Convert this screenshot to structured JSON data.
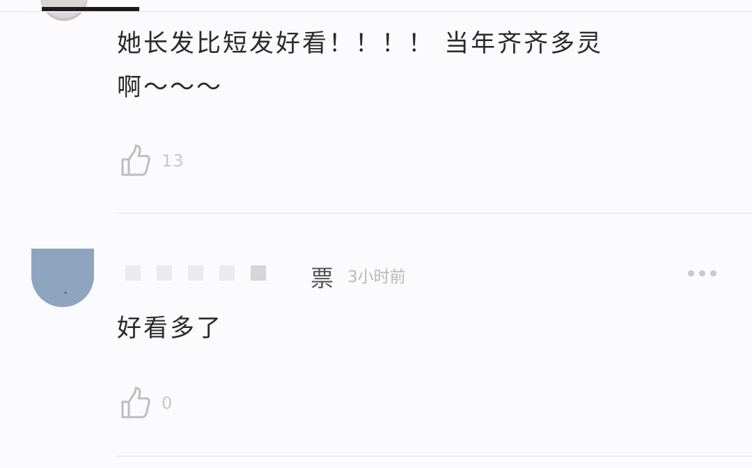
{
  "comments": [
    {
      "text_line1": "她长发比短发好看！！！！ 当年齐齐多灵",
      "text_line2": "啊～～～",
      "likes": "13"
    },
    {
      "username_visible": "票",
      "time": "3小时前",
      "text": "好看多了",
      "likes": "0"
    }
  ],
  "icons": {
    "like": "thumbs-up-icon",
    "more": "more-horizontal-icon"
  },
  "colors": {
    "background": "#fbfafc",
    "text": "#2a2a2a",
    "muted": "#c8c8cc",
    "avatar": "#8ea5bf"
  }
}
